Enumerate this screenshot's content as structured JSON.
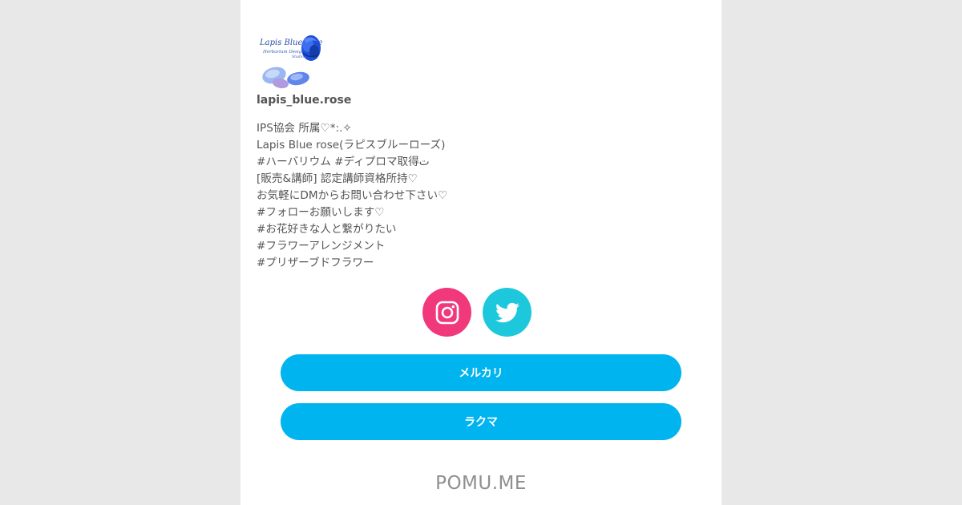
{
  "profile": {
    "avatar_icon": "lapis-blue-rose-logo-icon",
    "username": "lapis_blue.rose",
    "bio_lines": [
      "IPS協会 所属♡*:.✧",
      "Lapis Blue rose(ラピスブルーローズ)",
      "#ハーバリウム #ディプロマ取得ت",
      "[販売&講師] 認定講師資格所持♡",
      "お気軽にDMからお問い合わせ下さい♡",
      "#フォローお願いします♡",
      "#お花好きな人と繋がりたい",
      "#フラワーアレンジメント",
      "#プリザーブドフラワー"
    ]
  },
  "social": [
    {
      "name": "instagram-icon",
      "color": "#f0387b"
    },
    {
      "name": "twitter-icon",
      "color": "#1ec8dc"
    }
  ],
  "links": [
    {
      "label": "メルカリ"
    },
    {
      "label": "ラクマ"
    }
  ],
  "footer": {
    "logo_text": "POMU.ME"
  },
  "colors": {
    "button": "#00b4f0",
    "background": "#e8e8e8",
    "card": "#ffffff"
  }
}
